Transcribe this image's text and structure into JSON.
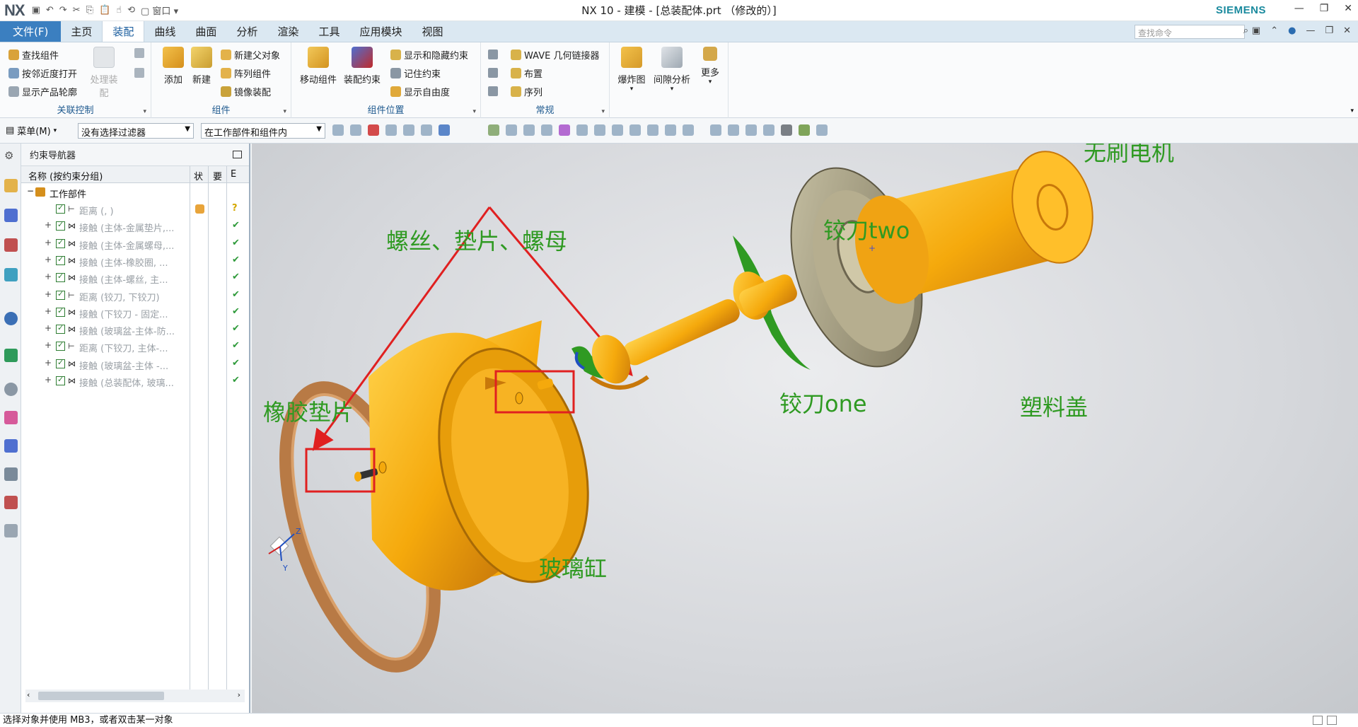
{
  "app": {
    "logo": "NX",
    "title": "NX 10 - 建模 - [总装配体.prt （修改的）]",
    "brand": "SIEMENS",
    "window_menu": "窗口"
  },
  "tabs": {
    "file": "文件(F)",
    "items": [
      "主页",
      "装配",
      "曲线",
      "曲面",
      "分析",
      "渲染",
      "工具",
      "应用模块",
      "视图"
    ],
    "active": "装配"
  },
  "search": {
    "placeholder": "查找命令"
  },
  "ribbon": {
    "group1": {
      "label": "关联控制",
      "items": [
        "查找组件",
        "按邻近度打开",
        "显示产品轮廓"
      ],
      "big_disabled": "处理装配"
    },
    "group2": {
      "label": "组件",
      "add": "添加",
      "new": "新建",
      "items": [
        "新建父对象",
        "阵列组件",
        "镜像装配"
      ]
    },
    "group3": {
      "label": "组件位置",
      "move": "移动组件",
      "constraint": "装配约束",
      "items": [
        "显示和隐藏约束",
        "记住约束",
        "显示自由度"
      ]
    },
    "group4": {
      "label": "常规",
      "items": [
        "WAVE 几何链接器",
        "布置",
        "序列"
      ]
    },
    "group5": {
      "explode": "爆炸图",
      "clearance": "间隙分析",
      "more": "更多"
    }
  },
  "selection_bar": {
    "menu": "菜单(M)",
    "filter": "没有选择过滤器",
    "scope": "在工作部件和组件内"
  },
  "navigator": {
    "title": "约束导航器",
    "columns": {
      "name": "名称 (按约束分组)",
      "c2": "状",
      "c3": "要",
      "c4": "E"
    },
    "root": "工作部件",
    "rows": [
      {
        "label": "距离 (, )",
        "icon": "distance-icon",
        "status": "?"
      },
      {
        "label": "接触 (主体-金属垫片,...",
        "icon": "touch-icon",
        "status": "✔"
      },
      {
        "label": "接触 (主体-金属螺母,...",
        "icon": "touch-icon",
        "status": "✔"
      },
      {
        "label": "接触 (主体-橡胶圈, ...",
        "icon": "touch-icon",
        "status": "✔"
      },
      {
        "label": "接触 (主体-螺丝, 主...",
        "icon": "touch-icon",
        "status": "✔"
      },
      {
        "label": "距离 (铰刀, 下铰刀)",
        "icon": "distance-icon",
        "status": "✔"
      },
      {
        "label": "接触 (下铰刀 - 固定...",
        "icon": "touch-icon",
        "status": "✔"
      },
      {
        "label": "接触 (玻璃盆-主体-防...",
        "icon": "touch-icon",
        "status": "✔"
      },
      {
        "label": "距离 (下铰刀, 主体-...",
        "icon": "distance-icon",
        "status": "✔"
      },
      {
        "label": "接触 (玻璃盆-主体 -...",
        "icon": "touch-icon",
        "status": "✔"
      },
      {
        "label": "接触 (总装配体, 玻璃...",
        "icon": "touch-icon",
        "status": "✔"
      }
    ]
  },
  "viewport": {
    "annotations": {
      "screws": "螺丝、垫片、螺母",
      "rubber": "橡胶垫片",
      "glass": "玻璃缸",
      "blade_one": "铰刀one",
      "blade_two": "铰刀two",
      "cover": "塑料盖",
      "motor": "无刷电机"
    },
    "axes": {
      "z": "Z",
      "y": "Y"
    },
    "colors": {
      "part": "#f5a90c",
      "rubber": "#b87a45",
      "cover": "#9c9478",
      "blade": "#2f9a22",
      "annotation": "#2f9a22",
      "highlight": "#e02020"
    }
  },
  "status": {
    "prompt": "选择对象并使用 MB3，或者双击某一对象"
  }
}
